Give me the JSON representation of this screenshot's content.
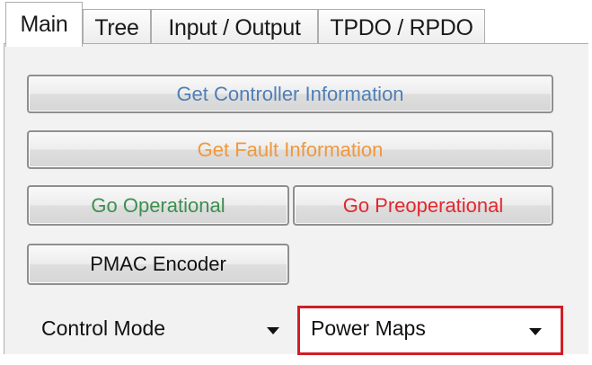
{
  "tabs": [
    {
      "label": "Main",
      "active": true
    },
    {
      "label": "Tree",
      "active": false
    },
    {
      "label": "Input / Output",
      "active": false
    },
    {
      "label": "TPDO / RPDO",
      "active": false
    }
  ],
  "buttons": {
    "get_controller_info": {
      "label": "Get Controller Information",
      "color": "#4f7fb6"
    },
    "get_fault_info": {
      "label": "Get Fault Information",
      "color": "#f0983c"
    },
    "go_operational": {
      "label": "Go Operational",
      "color": "#3c8f4f"
    },
    "go_preoperational": {
      "label": "Go Preoperational",
      "color": "#e2282e"
    },
    "pmac_encoder": {
      "label": "PMAC Encoder",
      "color": "#111111"
    }
  },
  "control_mode": {
    "label": "Control Mode",
    "label_arrow_icon": "dropdown-arrow-icon",
    "selected": "Power Maps",
    "dropdown_arrow_icon": "dropdown-arrow-icon",
    "highlight_color": "#d11e26"
  }
}
